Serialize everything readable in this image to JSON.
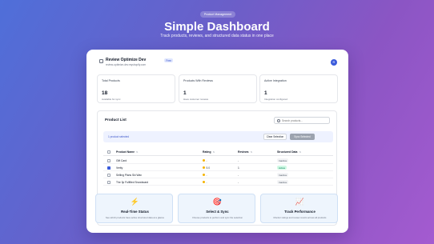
{
  "hero": {
    "badge": "Product Management",
    "title": "Simple Dashboard",
    "subtitle": "Track products, reviews, and structured data status in one place"
  },
  "store": {
    "name": "Review Optimize Dev",
    "tag": "Free",
    "email": "review-optimize-dev.myshopify.com",
    "avatar": "R"
  },
  "stats": [
    {
      "label": "Total Products",
      "value": "18",
      "hint": "Available for sync"
    },
    {
      "label": "Products With Reviews",
      "value": "1",
      "hint": "Have customer reviews"
    },
    {
      "label": "Active Integration",
      "value": "1",
      "hint": "Integration configured"
    }
  ],
  "product_list": {
    "title": "Product List",
    "search_placeholder": "Search products...",
    "selection_text": "1 product selected",
    "clear_label": "Clear Selection",
    "sync_label": "Sync Selected",
    "columns": {
      "name": "Product Name",
      "rating": "Rating",
      "reviews": "Reviews",
      "structured": "Structured Data"
    },
    "rows": [
      {
        "name": "Gift Card",
        "rating": "-",
        "reviews": "-",
        "status": "Inactive",
        "selected": false
      },
      {
        "name": "Verity",
        "rating": "5.0",
        "reviews": "1",
        "status": "Active",
        "selected": true
      },
      {
        "name": "Selling Plans Ski Wax",
        "rating": "-",
        "reviews": "-",
        "status": "Inactive",
        "selected": false
      },
      {
        "name": "The 3p Fulfilled Snowboard",
        "rating": "-",
        "reviews": "-",
        "status": "Inactive",
        "selected": false
      }
    ]
  },
  "features": [
    {
      "icon": "lightning-icon",
      "glyph": "⚡",
      "title": "Real-Time Status",
      "desc": "See which products have active structured data at a glance"
    },
    {
      "icon": "target-icon",
      "glyph": "🎯",
      "title": "Select & Sync",
      "desc": "Choose products to perform and sync the selection"
    },
    {
      "icon": "chart-icon",
      "glyph": "📈",
      "title": "Track Performance",
      "desc": "Monitor ratings and review counts across all products"
    }
  ],
  "colors": {
    "accent": "#3b5bdb",
    "active_green": "#047857",
    "star": "#f5b301"
  }
}
